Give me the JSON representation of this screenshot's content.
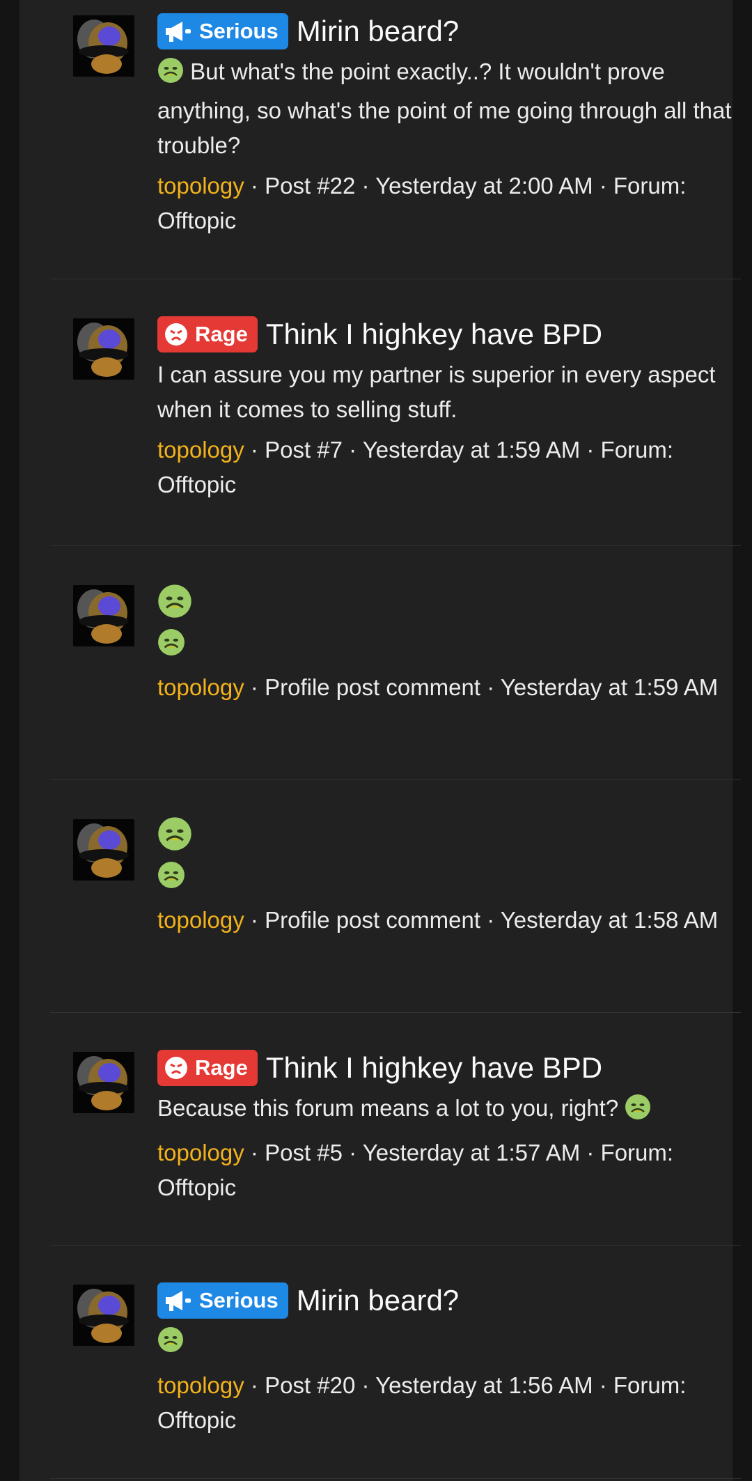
{
  "results": [
    {
      "badge": {
        "type": "serious",
        "label": "Serious"
      },
      "title": "Mirin beard?",
      "snippet_text": "But what's the point exactly..? It wouldn't prove anything, so what's the point of me going through all that trouble?",
      "user": "topology",
      "meta": " · Post #22 · Yesterday at 2:00 AM · Forum: Offtopic"
    },
    {
      "badge": {
        "type": "rage",
        "label": "Rage"
      },
      "title": "Think I highkey have BPD",
      "snippet_text": "I can assure you my partner is superior in every aspect when it comes to selling stuff.",
      "user": "topology",
      "meta": " · Post #7 · Yesterday at 1:59 AM · Forum: Offtopic"
    },
    {
      "user": "topology",
      "meta": " · Profile post comment · Yesterday at 1:59 AM"
    },
    {
      "user": "topology",
      "meta": " · Profile post comment · Yesterday at 1:58 AM"
    },
    {
      "badge": {
        "type": "rage",
        "label": "Rage"
      },
      "title": "Think I highkey have BPD",
      "snippet_text": "Because this forum means a lot to you, right?",
      "user": "topology",
      "meta": " · Post #5 · Yesterday at 1:57 AM · Forum: Offtopic"
    },
    {
      "badge": {
        "type": "serious",
        "label": "Serious"
      },
      "title": "Mirin beard?",
      "user": "topology",
      "meta": " · Post #20 · Yesterday at 1:56 AM · Forum: Offtopic"
    }
  ],
  "icons": {
    "serious": "megaphone-icon",
    "rage": "angry-face-icon",
    "emoji": "nauseated-face-emoji"
  },
  "colors": {
    "username": "#f3b21b",
    "serious_badge": "#1e88e5",
    "rage_badge": "#e53935",
    "background": "#212121"
  }
}
